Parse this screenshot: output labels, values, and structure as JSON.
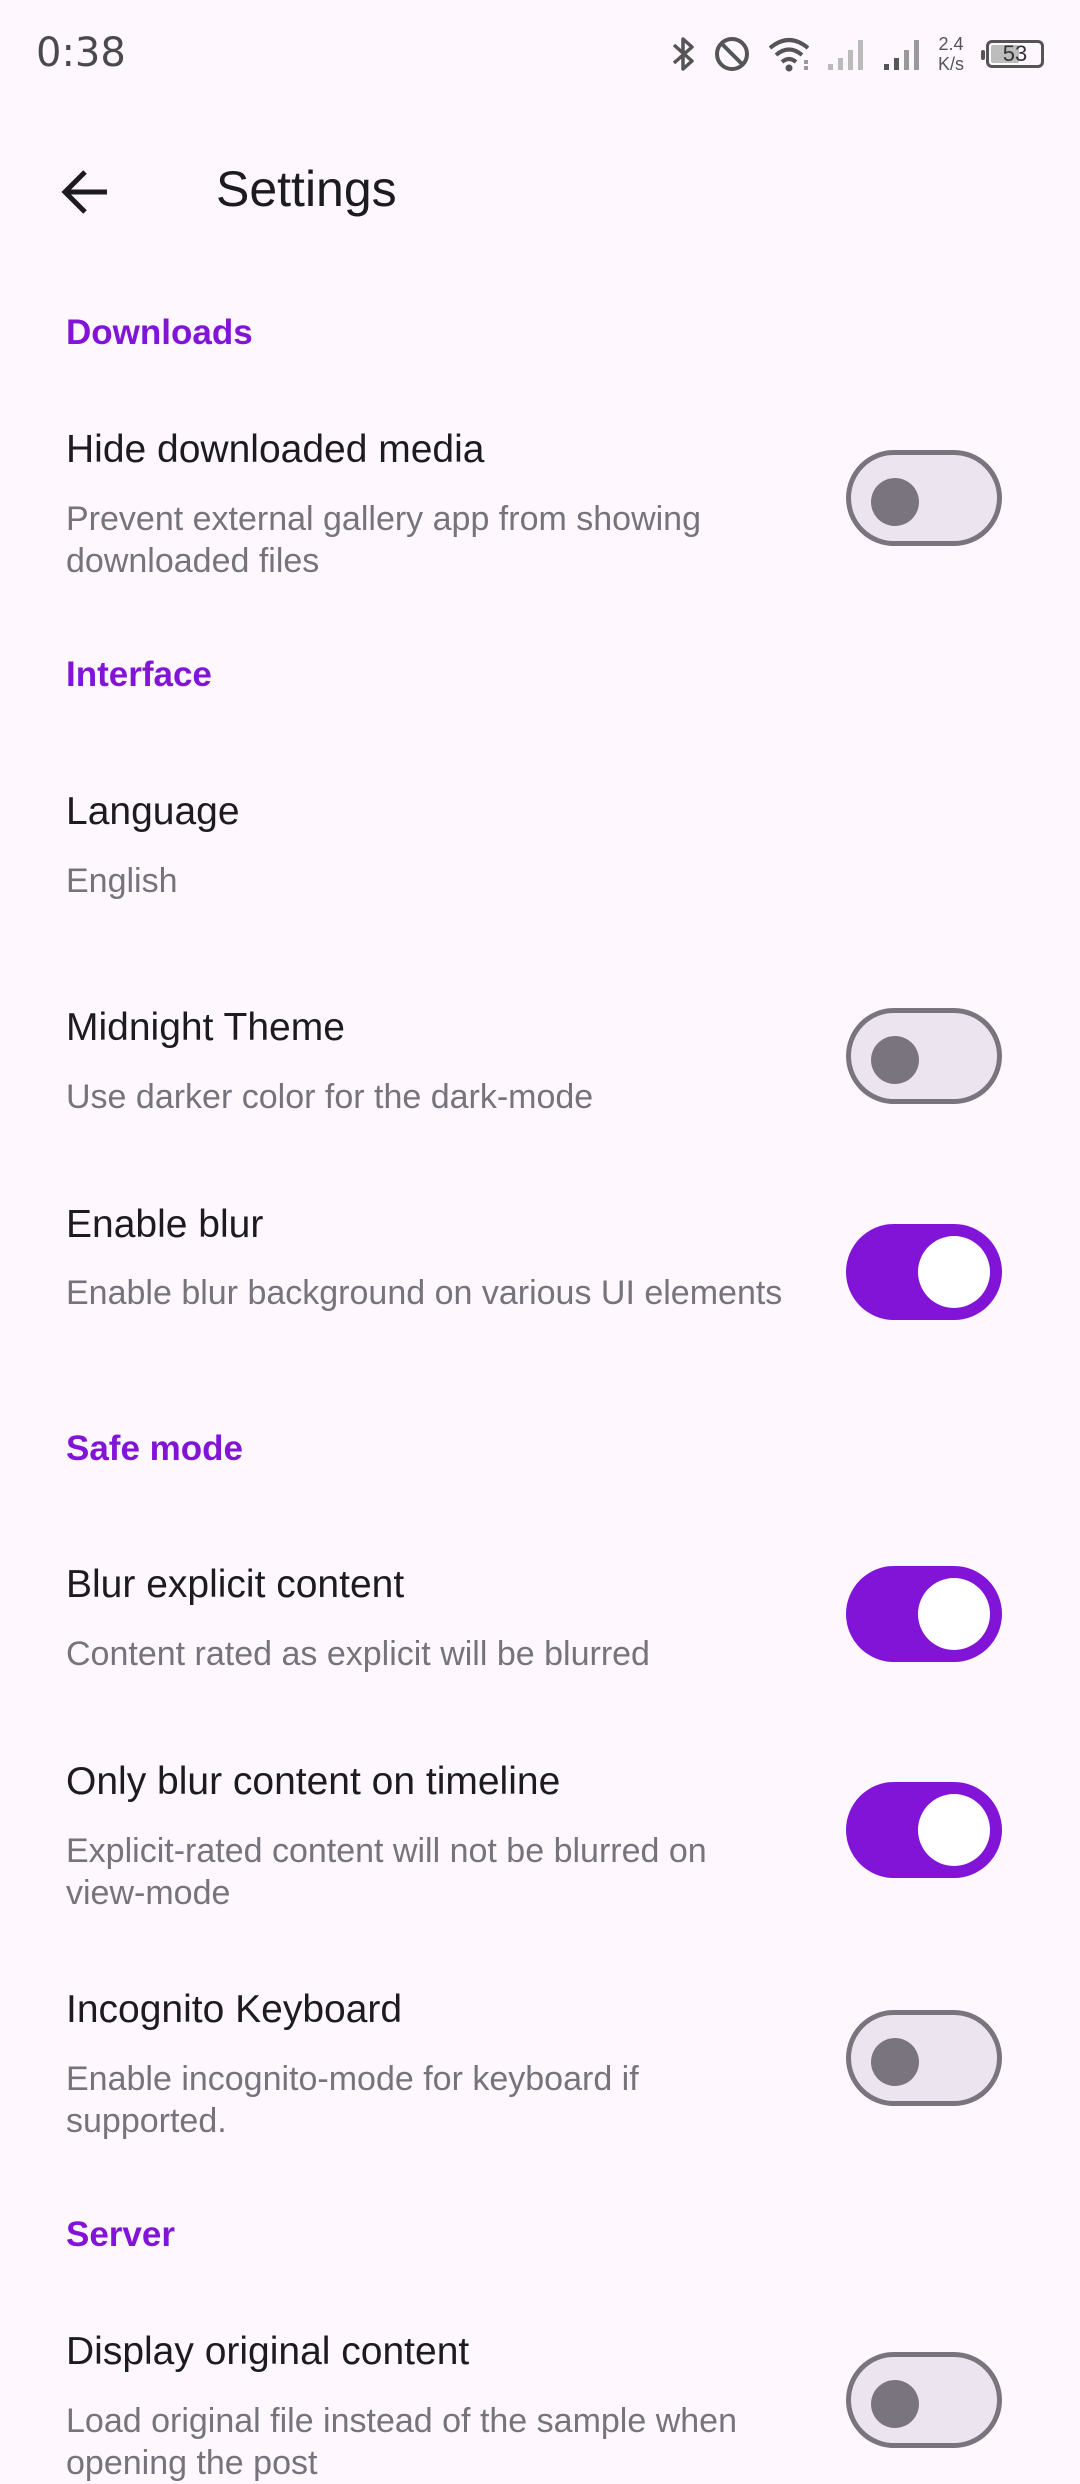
{
  "status": {
    "time": "0:38",
    "speed_value": "2.4",
    "speed_unit": "K/s",
    "battery": "53"
  },
  "header": {
    "title": "Settings"
  },
  "sections": {
    "downloads": "Downloads",
    "interface": "Interface",
    "safe_mode": "Safe mode",
    "server": "Server"
  },
  "items": {
    "hide_media": {
      "title": "Hide downloaded media",
      "sub": "Prevent external gallery app from showing downloaded files",
      "enabled": false
    },
    "language": {
      "title": "Language",
      "sub": "English"
    },
    "midnight": {
      "title": "Midnight Theme",
      "sub": "Use darker color for the dark-mode",
      "enabled": false
    },
    "blur": {
      "title": "Enable blur",
      "sub": "Enable blur background on various UI elements",
      "enabled": true
    },
    "blur_explicit": {
      "title": "Blur explicit content",
      "sub": "Content rated as explicit will be blurred",
      "enabled": true
    },
    "blur_timeline": {
      "title": "Only blur content on timeline",
      "sub": "Explicit-rated content will not be blurred on view-mode",
      "enabled": true
    },
    "incognito": {
      "title": "Incognito Keyboard",
      "sub": "Enable incognito-mode for keyboard if supported.",
      "enabled": false
    },
    "original": {
      "title": "Display original content",
      "sub": "Load original file instead of the sample when opening the post",
      "enabled": false
    }
  },
  "colors": {
    "accent": "#8214d8",
    "background": "#fef7fd",
    "switch_off_track": "#ece4ef",
    "switch_off_outline": "#79747e"
  },
  "icons": [
    "back-arrow-icon",
    "bluetooth-icon",
    "do-not-disturb-icon",
    "wifi-icon",
    "signal-icon",
    "battery-icon"
  ]
}
